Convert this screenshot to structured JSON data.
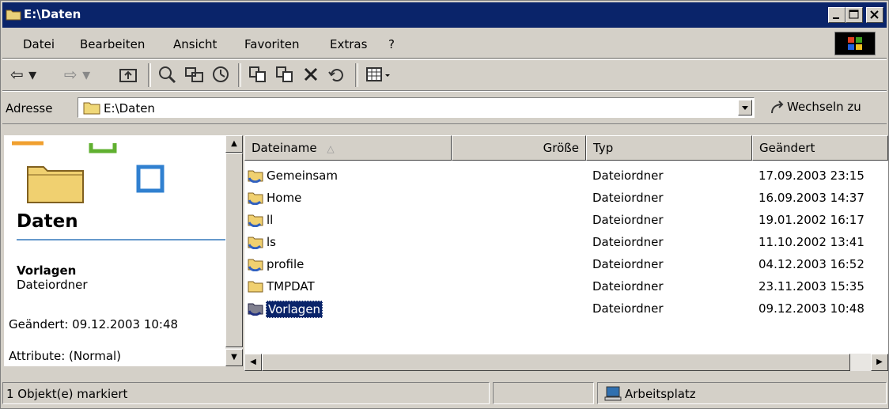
{
  "window": {
    "title": "E:\\Daten"
  },
  "menu": {
    "items": [
      {
        "label": "Datei"
      },
      {
        "label": "Bearbeiten"
      },
      {
        "label": "Ansicht"
      },
      {
        "label": "Favoriten"
      },
      {
        "label": "Extras"
      },
      {
        "label": "?"
      }
    ]
  },
  "toolbar": {
    "icons": [
      "back-arrow-icon",
      "forward-arrow-icon",
      "up-folder-icon",
      "search-icon",
      "folders-icon",
      "history-icon",
      "move-to-icon",
      "copy-to-icon",
      "delete-icon",
      "undo-icon",
      "views-icon"
    ]
  },
  "address": {
    "label": "Adresse",
    "value": "E:\\Daten",
    "go_label": "Wechseln zu"
  },
  "left_pane": {
    "folder_title": "Daten",
    "selected_name": "Vorlagen",
    "selected_type": "Dateiordner",
    "modified": "Geändert: 09.12.2003 10:48",
    "attributes": "Attribute: (Normal)"
  },
  "columns": {
    "name": "Dateiname",
    "size": "Größe",
    "type": "Typ",
    "modified": "Geändert"
  },
  "files": [
    {
      "name": "Gemeinsam",
      "type": "Dateiordner",
      "modified": "17.09.2003 23:15"
    },
    {
      "name": "Home",
      "type": "Dateiordner",
      "modified": "16.09.2003 14:37"
    },
    {
      "name": "ll",
      "type": "Dateiordner",
      "modified": "19.01.2002 16:17"
    },
    {
      "name": "ls",
      "type": "Dateiordner",
      "modified": "11.10.2002 13:41"
    },
    {
      "name": "profile",
      "type": "Dateiordner",
      "modified": "04.12.2003 16:52"
    },
    {
      "name": "TMPDAT",
      "type": "Dateiordner",
      "modified": "23.11.2003 15:35"
    },
    {
      "name": "Vorlagen",
      "type": "Dateiordner",
      "modified": "09.12.2003 10:48"
    }
  ],
  "status": {
    "selection": "1 Objekt(e) markiert",
    "location": "Arbeitsplatz"
  },
  "colors": {
    "titlebar": "#0a246a",
    "selection": "#0a246a",
    "face": "#d4d0c8"
  }
}
